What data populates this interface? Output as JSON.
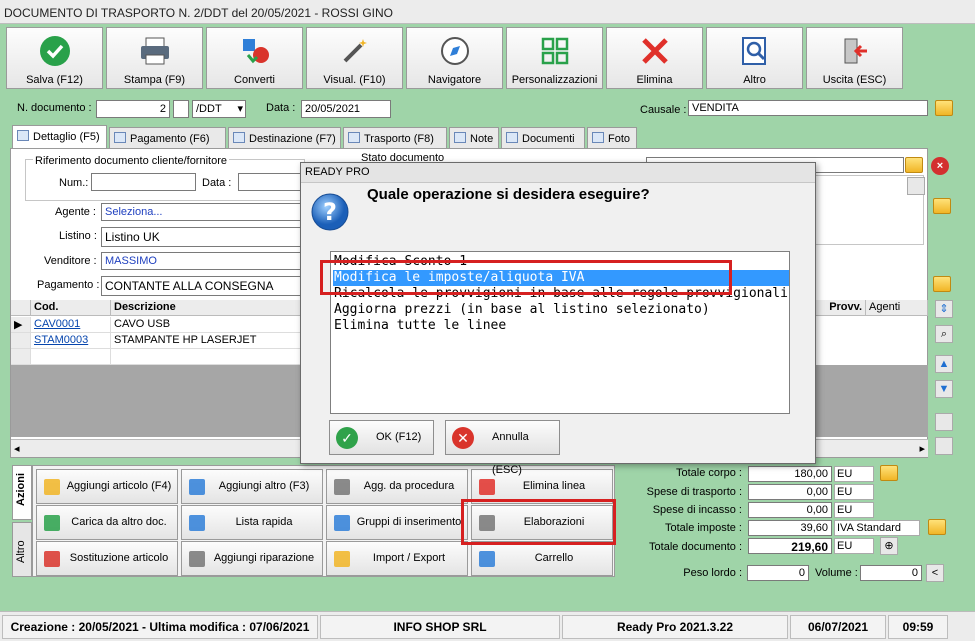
{
  "window": {
    "title": "DOCUMENTO DI TRASPORTO N. 2/DDT del 20/05/2021 - ROSSI GINO"
  },
  "toolbar": [
    {
      "label": "Salva (F12)",
      "icon": "check-icon"
    },
    {
      "label": "Stampa (F9)",
      "icon": "printer-icon"
    },
    {
      "label": "Converti",
      "icon": "convert-icon"
    },
    {
      "label": "Visual. (F10)",
      "icon": "magic-wand-icon"
    },
    {
      "label": "Navigatore",
      "icon": "compass-icon"
    },
    {
      "label": "Personalizzazioni",
      "icon": "grid-icon"
    },
    {
      "label": "Elimina",
      "icon": "delete-icon"
    },
    {
      "label": "Altro",
      "icon": "search-doc-icon"
    },
    {
      "label": "Uscita (ESC)",
      "icon": "exit-icon"
    }
  ],
  "header": {
    "ndoc_label": "N. documento :",
    "ndoc_value": "2",
    "series_value": "/DDT",
    "date_label": "Data :",
    "date_value": "20/05/2021",
    "causale_label": "Causale :",
    "causale_value": "VENDITA"
  },
  "tabs": [
    "Dettaglio (F5)",
    "Pagamento (F6)",
    "Destinazione (F7)",
    "Trasporto (F8)",
    "Note",
    "Documenti",
    "Foto"
  ],
  "rif": {
    "group_label": "Riferimento documento cliente/fornitore",
    "num_label": "Num.:",
    "data_label": "Data :",
    "stato_label": "Stato documento"
  },
  "fields": {
    "agente_label": "Agente :",
    "agente_value": "Seleziona...",
    "listino_label": "Listino :",
    "listino_value": "Listino UK",
    "venditore_label": "Venditore :",
    "venditore_value": "MASSIMO",
    "pagamento_label": "Pagamento :",
    "pagamento_value": "CONTANTE ALLA CONSEGNA"
  },
  "grid": {
    "col_cod": "Cod.",
    "col_desc": "Descrizione",
    "col_provv": "Provv.",
    "col_agenti": "Agenti",
    "rows": [
      {
        "cod": "CAV0001",
        "desc": "CAVO USB"
      },
      {
        "cod": "STAM0003",
        "desc": "STAMPANTE HP LASERJET"
      }
    ]
  },
  "side_tabs": [
    "Azioni",
    "Altro"
  ],
  "actions": [
    "Aggiungi articolo (F4)",
    "Aggiungi altro (F3)",
    "Agg. da procedura",
    "Elimina linea",
    "Carica da altro doc.",
    "Lista rapida",
    "Gruppi di inserimento",
    "Elaborazioni",
    "Sostituzione articolo",
    "Aggiungi riparazione",
    "Import / Export",
    "Carrello"
  ],
  "totals": {
    "corpo_label": "Totale corpo :",
    "corpo_value": "180,00",
    "corpo_unit": "EU",
    "trasp_label": "Spese di trasporto :",
    "trasp_value": "0,00",
    "trasp_unit": "EU",
    "incasso_label": "Spese di incasso :",
    "incasso_value": "0,00",
    "incasso_unit": "EU",
    "imposte_label": "Totale imposte :",
    "imposte_value": "39,60",
    "imposte_unit": "IVA Standard",
    "doc_label": "Totale documento :",
    "doc_value": "219,60",
    "doc_unit": "EU",
    "peso_label": "Peso lordo :",
    "peso_value": "0",
    "volume_label": "Volume :",
    "volume_value": "0",
    "lt": "<"
  },
  "status": {
    "dates": "Creazione : 20/05/2021 - Ultima modifica : 07/06/2021",
    "company": "INFO SHOP SRL",
    "version": "Ready Pro 2021.3.22",
    "date": "06/07/2021",
    "time": "09:59"
  },
  "dialog": {
    "title": "READY PRO",
    "question": "Quale operazione si desidera eseguire?",
    "options": [
      "Modifica Sconto 1",
      "Modifica le imposte/aliquota IVA",
      "Ricalcola le provvigioni in base alle regole provvigionali",
      "Aggiorna prezzi (in base al listino selezionato)",
      "Elimina tutte le linee"
    ],
    "selected_index": 1,
    "ok_label": "OK (F12)",
    "cancel_label": "Annulla (ESC)"
  },
  "colors": {
    "background": "#9fd4a8",
    "selection": "#3399ff",
    "highlight": "#d62020"
  }
}
